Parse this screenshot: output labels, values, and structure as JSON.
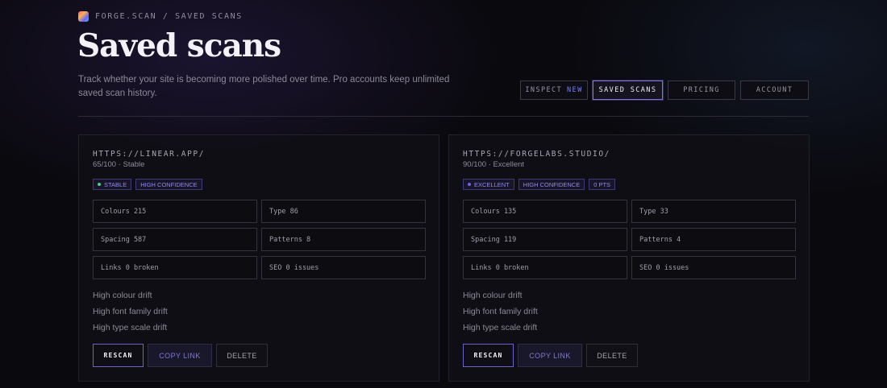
{
  "header": {
    "breadcrumb": "FORGE.SCAN / SAVED SCANS",
    "title": "Saved scans",
    "subtitle": "Track whether your site is becoming more polished over time. Pro accounts keep unlimited saved scan history."
  },
  "nav": {
    "inspect": "INSPECT",
    "inspect_badge": "NEW",
    "saved_scans": "SAVED SCANS",
    "pricing": "PRICING",
    "account": "ACCOUNT"
  },
  "scans": [
    {
      "url": "HTTPS://LINEAR.APP/",
      "score": "65/100 · Stable",
      "badges": [
        "STABLE",
        "HIGH CONFIDENCE"
      ],
      "stats": [
        "Colours 215",
        "Type 86",
        "Spacing 587",
        "Patterns 8",
        "Links 0 broken",
        "SEO 0 issues"
      ],
      "drifts": [
        "High colour drift",
        "High font family drift",
        "High type scale drift"
      ],
      "actions": {
        "rescan": "RESCAN",
        "copy": "COPY LINK",
        "delete": "DELETE"
      }
    },
    {
      "url": "HTTPS://FORGELABS.STUDIO/",
      "score": "90/100 · Excellent",
      "badges": [
        "EXCELLENT",
        "HIGH CONFIDENCE",
        "0 PTS"
      ],
      "stats": [
        "Colours 135",
        "Type 33",
        "Spacing 119",
        "Patterns 4",
        "Links 0 broken",
        "SEO 0 issues"
      ],
      "drifts": [
        "High colour drift",
        "High font family drift",
        "High type scale drift"
      ],
      "actions": {
        "rescan": "RESCAN",
        "copy": "COPY LINK",
        "delete": "DELETE"
      }
    }
  ],
  "colors": {
    "accent": "#7c74d9",
    "badge_text": "#8f8cf0",
    "status_dot": "#3bd48a"
  }
}
